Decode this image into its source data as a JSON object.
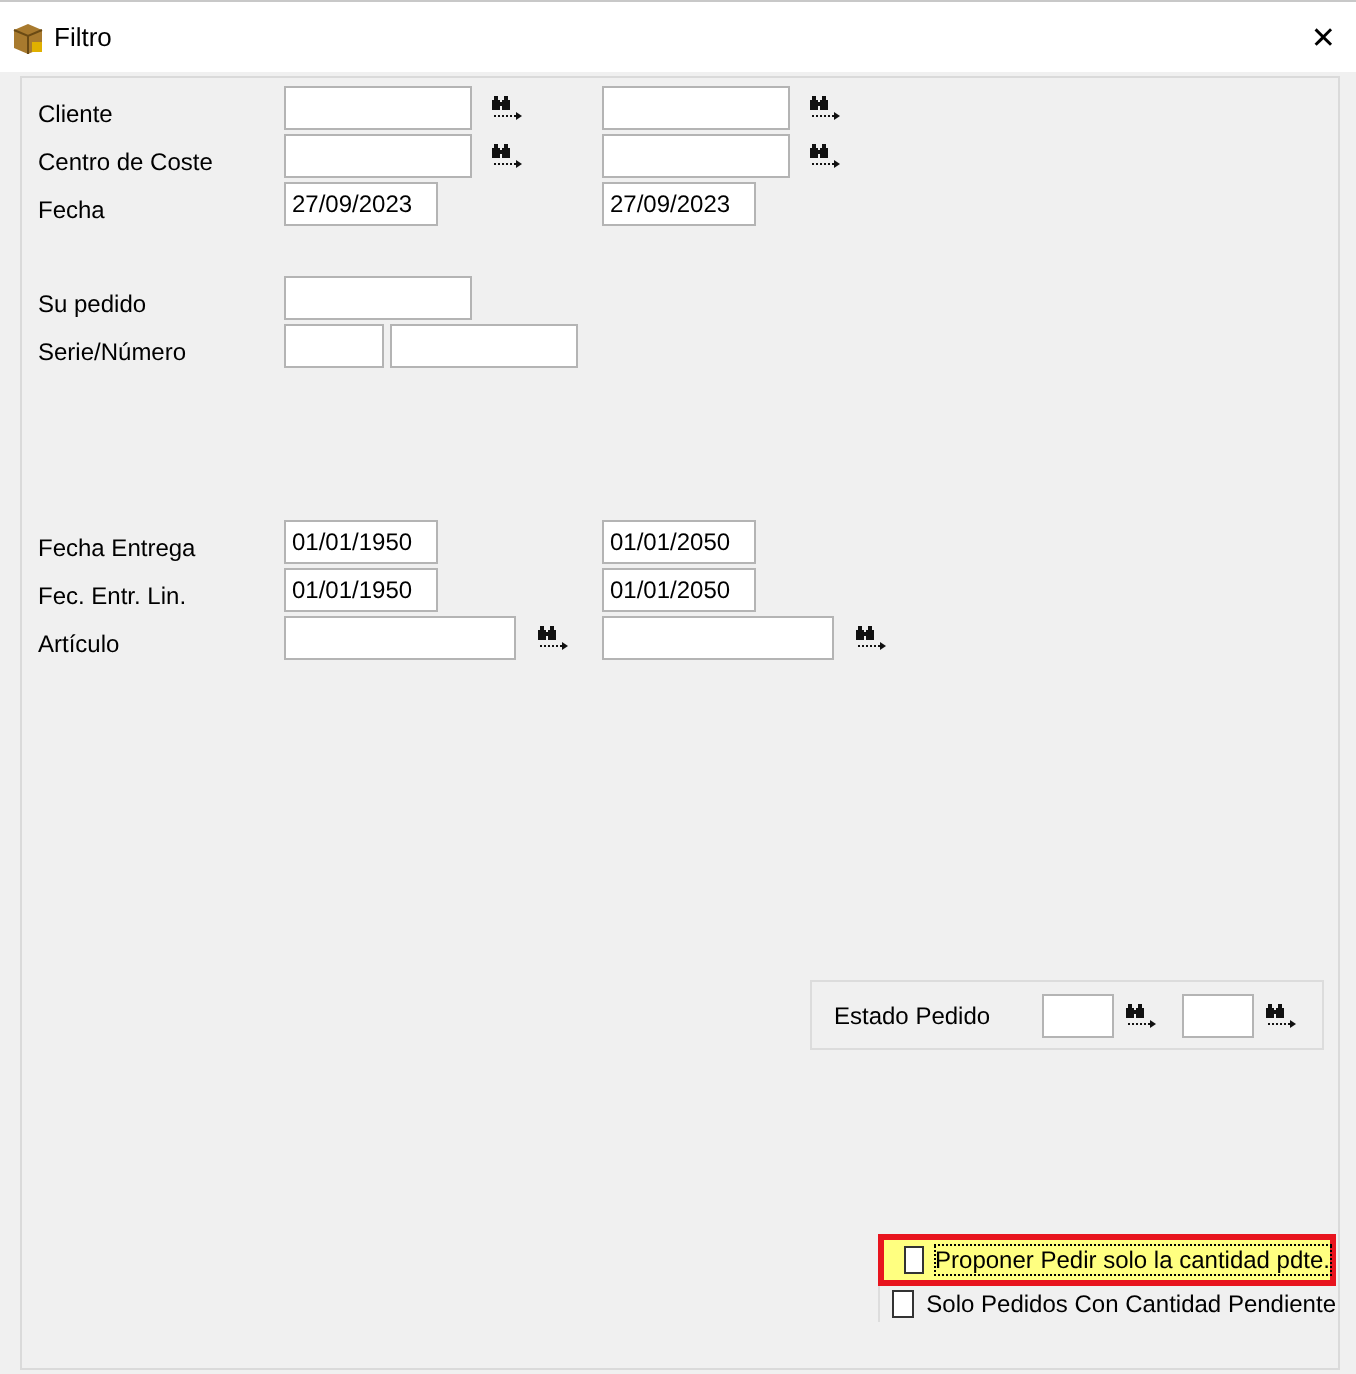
{
  "window": {
    "title": "Filtro",
    "close": "✕"
  },
  "sections": [
    [
      {
        "label": "Cliente",
        "inputs": [
          {
            "kind": "long",
            "lookup": true
          },
          {
            "kind": "long",
            "lookup": true
          }
        ]
      },
      {
        "label": "Centro de Coste",
        "inputs": [
          {
            "kind": "long",
            "lookup": true
          },
          {
            "kind": "long",
            "lookup": true
          }
        ]
      },
      {
        "label": "Fecha",
        "inputs": [
          {
            "kind": "date",
            "value": "27/09/2023",
            "lookup": false
          },
          {
            "kind": "date",
            "value": "27/09/2023",
            "lookup": false
          }
        ]
      }
    ],
    [
      {
        "label": "Su pedido",
        "inputs": [
          {
            "kind": "long",
            "lookup": false
          }
        ]
      },
      {
        "label": "Serie/Número",
        "inputs": [
          {
            "kind": "short",
            "lookup": false
          },
          {
            "kind": "long",
            "lookup": false
          }
        ]
      }
    ],
    [
      {
        "label": "Fecha Entrega",
        "inputs": [
          {
            "kind": "date",
            "value": "01/01/1950",
            "lookup": false
          },
          {
            "kind": "date",
            "value": "01/01/2050",
            "lookup": false
          }
        ]
      },
      {
        "label": "Fec. Entr. Lin.",
        "inputs": [
          {
            "kind": "date",
            "value": "01/01/1950",
            "lookup": false
          },
          {
            "kind": "date",
            "value": "01/01/2050",
            "lookup": false
          }
        ]
      },
      {
        "label": "Artículo",
        "inputs": [
          {
            "kind": "wide",
            "lookup": true
          },
          {
            "kind": "wide",
            "lookup": true
          }
        ]
      }
    ]
  ],
  "estado": {
    "label": "Estado Pedido",
    "inputs": [
      {
        "kind": "tiny",
        "lookup": true
      },
      {
        "kind": "tiny",
        "lookup": true
      }
    ]
  },
  "checkboxes": [
    {
      "label": "Proponer Pedir solo la cantidad pdte.",
      "checked": false,
      "highlighted": true
    },
    {
      "label": "Solo Pedidos Con Cantidad Pendiente",
      "checked": false,
      "highlighted": false
    }
  ]
}
